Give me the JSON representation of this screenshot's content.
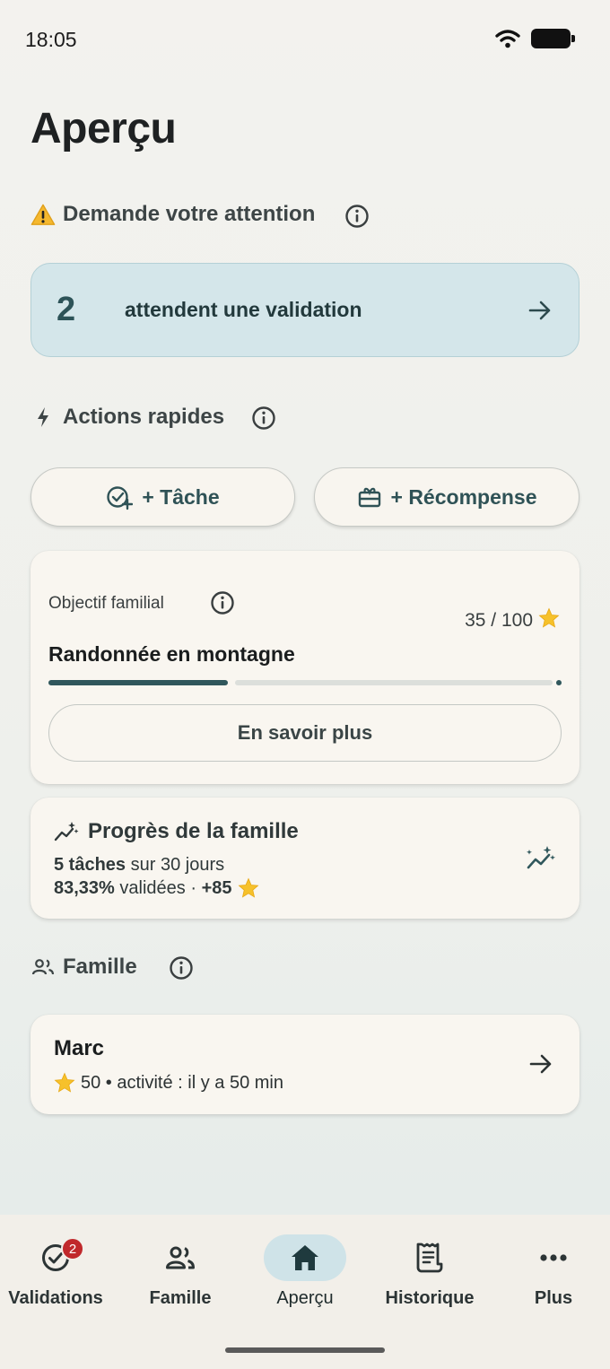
{
  "status_bar": {
    "time": "18:05"
  },
  "page": {
    "title": "Aperçu"
  },
  "attention": {
    "heading": "Demande votre attention",
    "count": "2",
    "label": "attendent une validation"
  },
  "quick_actions": {
    "heading": "Actions rapides",
    "task_label": "+ Tâche",
    "reward_label": "+ Récompense"
  },
  "family_goal": {
    "label": "Objectif familial",
    "name": "Randonnée en montagne",
    "progress_text": "35 / 100",
    "progress_value": 35,
    "progress_max": 100,
    "learn_more_label": "En savoir plus"
  },
  "family_progress": {
    "title": "Progrès de la famille",
    "tasks_count": "5 tâches",
    "tasks_period": " sur 30 jours",
    "validated_pct": "83,33%",
    "validated_text": " validées · ",
    "points": "+85"
  },
  "family": {
    "heading": "Famille",
    "members": [
      {
        "name": "Marc",
        "meta": "50 • activité : il y a 50 min"
      }
    ]
  },
  "bottom_nav": {
    "items": [
      {
        "label": "Validations",
        "badge": "2",
        "icon": "check-circle-icon"
      },
      {
        "label": "Famille",
        "icon": "people-icon"
      },
      {
        "label": "Aperçu",
        "icon": "home-icon",
        "active": true
      },
      {
        "label": "Historique",
        "icon": "receipt-icon"
      },
      {
        "label": "Plus",
        "icon": "more-horizontal-icon"
      }
    ]
  },
  "colors": {
    "accent": "#30575c",
    "attention_bg": "#d4e6ea",
    "badge": "#c0282b",
    "card_bg": "#f9f6f0"
  }
}
